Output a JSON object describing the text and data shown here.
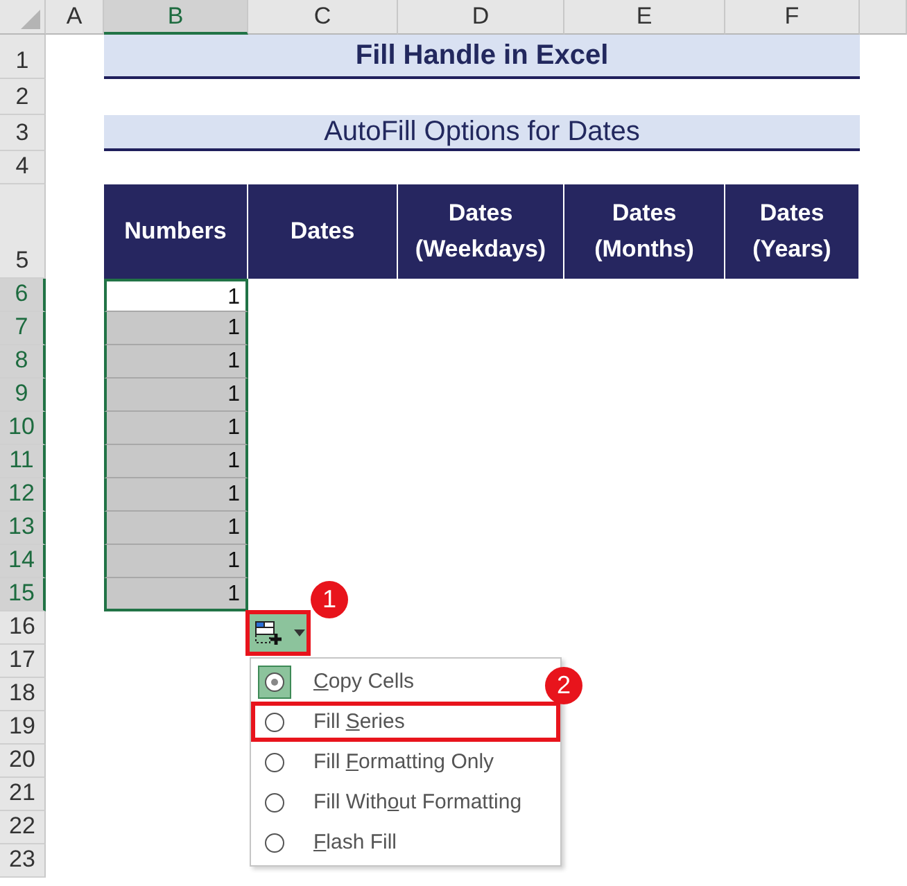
{
  "columns": [
    {
      "label": "A",
      "selected": false
    },
    {
      "label": "B",
      "selected": true
    },
    {
      "label": "C",
      "selected": false
    },
    {
      "label": "D",
      "selected": false
    },
    {
      "label": "E",
      "selected": false
    },
    {
      "label": "F",
      "selected": false
    }
  ],
  "rows": [
    {
      "label": "1",
      "selected": false
    },
    {
      "label": "2",
      "selected": false
    },
    {
      "label": "3",
      "selected": false
    },
    {
      "label": "4",
      "selected": false
    },
    {
      "label": "5",
      "selected": false
    },
    {
      "label": "6",
      "selected": true
    },
    {
      "label": "7",
      "selected": true
    },
    {
      "label": "8",
      "selected": true
    },
    {
      "label": "9",
      "selected": true
    },
    {
      "label": "10",
      "selected": true
    },
    {
      "label": "11",
      "selected": true
    },
    {
      "label": "12",
      "selected": true
    },
    {
      "label": "13",
      "selected": true
    },
    {
      "label": "14",
      "selected": true
    },
    {
      "label": "15",
      "selected": true
    },
    {
      "label": "16",
      "selected": false
    },
    {
      "label": "17",
      "selected": false
    },
    {
      "label": "18",
      "selected": false
    },
    {
      "label": "19",
      "selected": false
    },
    {
      "label": "20",
      "selected": false
    },
    {
      "label": "21",
      "selected": false
    },
    {
      "label": "22",
      "selected": false
    },
    {
      "label": "23",
      "selected": false
    }
  ],
  "title": "Fill Handle in Excel",
  "subtitle": "AutoFill Options for Dates",
  "table": {
    "columns": [
      "Numbers",
      "Dates",
      "Dates (Weekdays)",
      "Dates (Months)",
      "Dates (Years)"
    ],
    "numbers": [
      {
        "value": "1",
        "active": true
      },
      {
        "value": "1",
        "active": false
      },
      {
        "value": "1",
        "active": false
      },
      {
        "value": "1",
        "active": false
      },
      {
        "value": "1",
        "active": false
      },
      {
        "value": "1",
        "active": false
      },
      {
        "value": "1",
        "active": false
      },
      {
        "value": "1",
        "active": false
      },
      {
        "value": "1",
        "active": false
      },
      {
        "value": "1",
        "active": false
      }
    ]
  },
  "autofill_button": {
    "annotated": true
  },
  "menu": {
    "options": [
      {
        "access_key": "C",
        "label_after": "opy Cells",
        "selected": true,
        "annotated": false
      },
      {
        "label_before": "Fill ",
        "access_key": "S",
        "label_after": "eries",
        "selected": false,
        "annotated": true
      },
      {
        "label_before": "Fill ",
        "access_key": "F",
        "label_after": "ormatting Only",
        "selected": false,
        "annotated": false
      },
      {
        "label_before": "Fill With",
        "access_key": "o",
        "label_after": "ut Formatting",
        "selected": false,
        "annotated": false
      },
      {
        "access_key": "F",
        "label_after": "lash Fill",
        "selected": false,
        "annotated": false
      }
    ]
  },
  "callouts": [
    {
      "number": "1"
    },
    {
      "number": "2"
    }
  ]
}
